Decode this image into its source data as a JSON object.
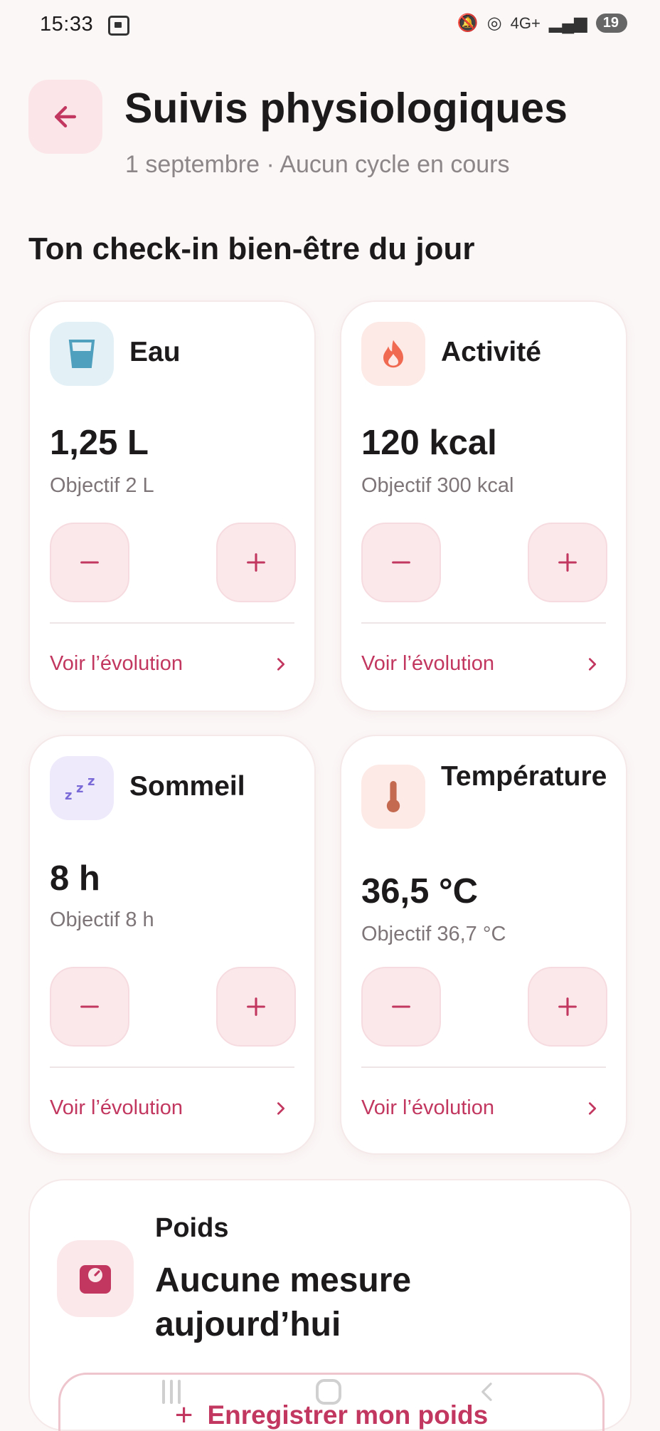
{
  "status_bar": {
    "time": "15:33",
    "network": "4G+",
    "battery": "19"
  },
  "header": {
    "title": "Suivis physiologiques",
    "subtitle": "1 septembre · Aucun cycle en cours"
  },
  "section_title": "Ton check-in bien-être du jour",
  "cards": [
    {
      "title": "Eau",
      "value": "1,25 L",
      "goal": "Objectif 2 L",
      "link": "Voir l’évolution",
      "icon": "water-glass-icon",
      "icon_bg": "#e3f1f7",
      "icon_color": "#4f9fbf"
    },
    {
      "title": "Activité",
      "value": "120 kcal",
      "goal": "Objectif 300 kcal",
      "link": "Voir l’évolution",
      "icon": "flame-icon",
      "icon_bg": "#fde9e5",
      "icon_color": "#f06a52"
    },
    {
      "title": "Sommeil",
      "value": "8 h",
      "goal": "Objectif 8 h",
      "link": "Voir l’évolution",
      "icon": "sleep-zzz-icon",
      "icon_bg": "#eeeafb",
      "icon_color": "#7a6ad8"
    },
    {
      "title": "Température",
      "value": "36,5 °C",
      "goal": "Objectif 36,7 °C",
      "link": "Voir l’évolution",
      "icon": "thermometer-icon",
      "icon_bg": "#fde9e5",
      "icon_color": "#c46a50"
    }
  ],
  "weight": {
    "label": "Poids",
    "status": "Aucune mesure aujourd’hui",
    "button_label": "Enregistrer mon poids",
    "icon": "scale-icon"
  },
  "colors": {
    "accent": "#c2375f",
    "background": "#fbf7f6",
    "button_bg": "#fbe8eb"
  }
}
